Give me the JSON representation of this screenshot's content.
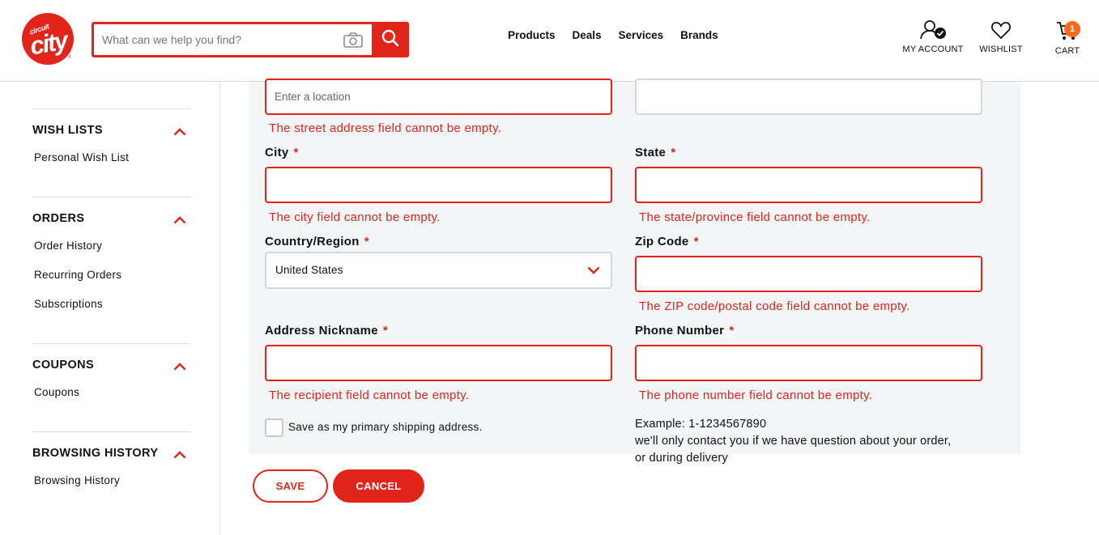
{
  "header": {
    "logo_small": "circuit",
    "logo_big": "city",
    "search_placeholder": "What can we help you find?",
    "nav": [
      "Products",
      "Deals",
      "Services",
      "Brands"
    ],
    "account_label": "MY ACCOUNT",
    "wishlist_label": "WISHLIST",
    "cart_label": "CART",
    "cart_count": "1",
    "brand_color": "#e1251b"
  },
  "sidebar": {
    "sections": [
      {
        "title": "WISH LISTS",
        "items": [
          "Personal Wish List"
        ]
      },
      {
        "title": "ORDERS",
        "items": [
          "Order History",
          "Recurring Orders",
          "Subscriptions"
        ]
      },
      {
        "title": "COUPONS",
        "items": [
          "Coupons"
        ]
      },
      {
        "title": "BROWSING HISTORY",
        "items": [
          "Browsing History"
        ]
      }
    ]
  },
  "form": {
    "street_placeholder": "Enter a location",
    "street_error": "The street address field cannot be empty.",
    "city_label": "City",
    "city_error": "The city field cannot be empty.",
    "state_label": "State",
    "state_error": "The state/province field cannot be empty.",
    "country_label": "Country/Region",
    "country_value": "United States",
    "zip_label": "Zip Code",
    "zip_error": "The ZIP code/postal code field cannot be empty.",
    "nickname_label": "Address Nickname",
    "nickname_error": "The recipient field cannot be empty.",
    "phone_label": "Phone Number",
    "phone_error": "The phone number field cannot be empty.",
    "required_mark": "*",
    "primary_checkbox_label": "Save as my primary shipping address.",
    "phone_hint_1": "Example: 1-1234567890",
    "phone_hint_2": "we'll only contact you if we have question about your order,",
    "phone_hint_3": "or during delivery",
    "save_label": "SAVE",
    "cancel_label": "CANCEL"
  }
}
